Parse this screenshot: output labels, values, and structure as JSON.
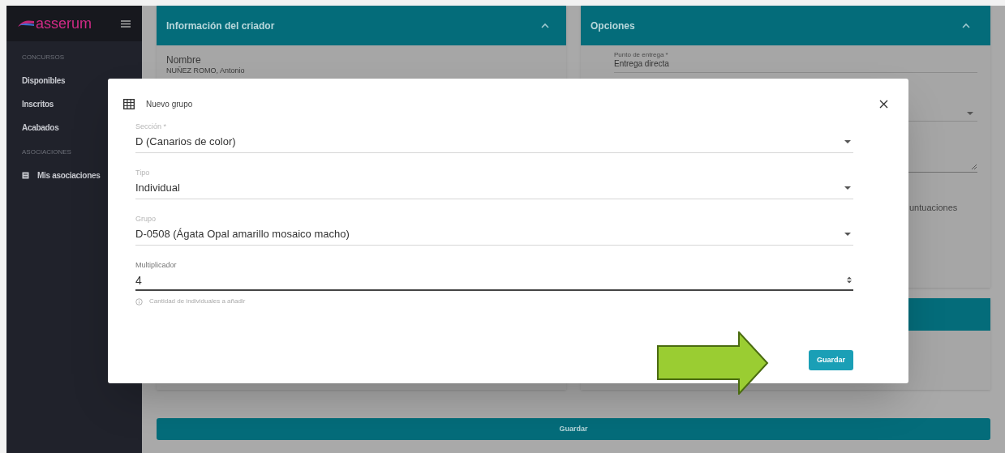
{
  "sidebar": {
    "logo": "asserum",
    "sections": [
      {
        "heading": "CONCURSOS",
        "items": [
          {
            "label": "Disponibles",
            "icon": false
          },
          {
            "label": "Inscritos",
            "icon": false
          },
          {
            "label": "Acabados",
            "icon": false
          }
        ]
      },
      {
        "heading": "ASOCIACIONES",
        "items": [
          {
            "label": "Mis asociaciones",
            "icon": true
          }
        ]
      }
    ]
  },
  "breeder_card": {
    "title": "Información del criador",
    "expanded": true,
    "field_label": "Nombre",
    "field_value": "NUÑEZ ROMO, Antonio"
  },
  "options_card": {
    "title": "Opciones",
    "expanded": true,
    "delivery_label": "Punto de entrega *",
    "delivery_value": "Entrega directa",
    "partial_text": "untuaciones"
  },
  "save_bar": {
    "label": "Guardar"
  },
  "dialog": {
    "title": "Nuevo grupo",
    "fields": [
      {
        "kind": "select",
        "label": "Sección *",
        "value": "D (Canarios de color)"
      },
      {
        "kind": "select",
        "label": "Tipo",
        "value": "Individual"
      },
      {
        "kind": "select",
        "label": "Grupo",
        "value": "D-0508 (Ágata Opal amarillo mosaico macho)"
      },
      {
        "kind": "number",
        "label": "Multiplicador",
        "value": "4",
        "hint": "Cantidad de individuales a añadir"
      }
    ],
    "save_button": "Guardar"
  }
}
